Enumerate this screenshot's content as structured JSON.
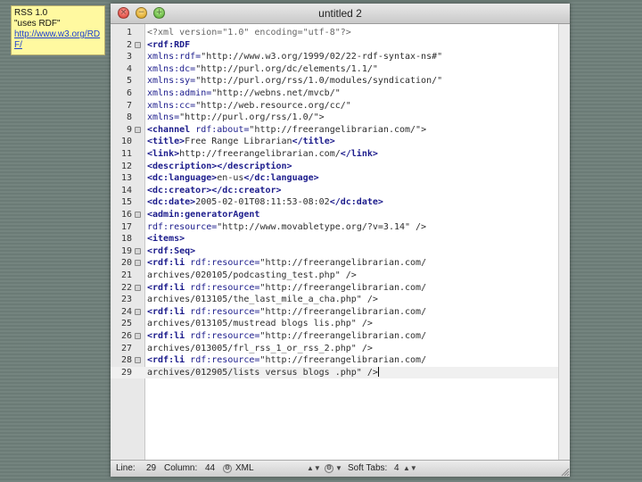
{
  "note": {
    "line1": "RSS 1.0",
    "line2": "\"uses RDF\"",
    "link": "http://www.w3.org/RDF/"
  },
  "window": {
    "title": "untitled 2"
  },
  "editor": {
    "lines": [
      {
        "n": "1",
        "fold": false,
        "parts": [
          [
            "c",
            "<?xml version=\"1.0\" encoding=\"utf-8\"?>"
          ]
        ]
      },
      {
        "n": "2",
        "fold": true,
        "parts": [
          [
            "t",
            "<rdf:RDF"
          ]
        ]
      },
      {
        "n": "3",
        "fold": false,
        "parts": [
          [
            "a",
            "xmlns:rdf="
          ],
          [
            "s",
            "\"http://www.w3.org/1999/02/22-rdf-syntax-ns#\""
          ]
        ]
      },
      {
        "n": "4",
        "fold": false,
        "parts": [
          [
            "a",
            "xmlns:dc="
          ],
          [
            "s",
            "\"http://purl.org/dc/elements/1.1/\""
          ]
        ]
      },
      {
        "n": "5",
        "fold": false,
        "parts": [
          [
            "a",
            "xmlns:sy="
          ],
          [
            "s",
            "\"http://purl.org/rss/1.0/modules/syndication/\""
          ]
        ]
      },
      {
        "n": "6",
        "fold": false,
        "parts": [
          [
            "a",
            "xmlns:admin="
          ],
          [
            "s",
            "\"http://webns.net/mvcb/\""
          ]
        ]
      },
      {
        "n": "7",
        "fold": false,
        "parts": [
          [
            "a",
            "xmlns:cc="
          ],
          [
            "s",
            "\"http://web.resource.org/cc/\""
          ]
        ]
      },
      {
        "n": "8",
        "fold": false,
        "parts": [
          [
            "a",
            "xmlns="
          ],
          [
            "s",
            "\"http://purl.org/rss/1.0/\">"
          ]
        ]
      },
      {
        "n": "9",
        "fold": true,
        "parts": [
          [
            "t",
            "<channel "
          ],
          [
            "a",
            "rdf:about="
          ],
          [
            "s",
            "\"http://freerangelibrarian.com/\">"
          ]
        ]
      },
      {
        "n": "10",
        "fold": false,
        "parts": [
          [
            "t",
            "<title>"
          ],
          [
            "s",
            "Free Range Librarian"
          ],
          [
            "t",
            "</title>"
          ]
        ]
      },
      {
        "n": "11",
        "fold": false,
        "parts": [
          [
            "t",
            "<link>"
          ],
          [
            "s",
            "http://freerangelibrarian.com/"
          ],
          [
            "t",
            "</link>"
          ]
        ]
      },
      {
        "n": "12",
        "fold": false,
        "parts": [
          [
            "t",
            "<description></description>"
          ]
        ]
      },
      {
        "n": "13",
        "fold": false,
        "parts": [
          [
            "t",
            "<dc:language>"
          ],
          [
            "s",
            "en-us"
          ],
          [
            "t",
            "</dc:language>"
          ]
        ]
      },
      {
        "n": "14",
        "fold": false,
        "parts": [
          [
            "t",
            "<dc:creator></dc:creator>"
          ]
        ]
      },
      {
        "n": "15",
        "fold": false,
        "parts": [
          [
            "t",
            "<dc:date>"
          ],
          [
            "s",
            "2005-02-01T08:11:53-08:02"
          ],
          [
            "t",
            "</dc:date>"
          ]
        ]
      },
      {
        "n": "16",
        "fold": true,
        "parts": [
          [
            "t",
            "<admin:generatorAgent"
          ]
        ]
      },
      {
        "n": "17",
        "fold": false,
        "parts": [
          [
            "a",
            "rdf:resource="
          ],
          [
            "s",
            "\"http://www.movabletype.org/?v=3.14\" />"
          ]
        ]
      },
      {
        "n": "18",
        "fold": false,
        "parts": [
          [
            "t",
            "<items>"
          ]
        ]
      },
      {
        "n": "19",
        "fold": true,
        "parts": [
          [
            "t",
            "<rdf:Seq>"
          ]
        ]
      },
      {
        "n": "20",
        "fold": true,
        "parts": [
          [
            "t",
            "<rdf:li "
          ],
          [
            "a",
            "rdf:resource="
          ],
          [
            "s",
            "\"http://freerangelibrarian.com/"
          ]
        ]
      },
      {
        "n": "21",
        "fold": false,
        "parts": [
          [
            "s",
            "archives/020105/podcasting_test.php\" />"
          ]
        ]
      },
      {
        "n": "22",
        "fold": true,
        "parts": [
          [
            "t",
            "<rdf:li "
          ],
          [
            "a",
            "rdf:resource="
          ],
          [
            "s",
            "\"http://freerangelibrarian.com/"
          ]
        ]
      },
      {
        "n": "23",
        "fold": false,
        "parts": [
          [
            "s",
            "archives/013105/the_last_mile_a_cha.php\" />"
          ]
        ]
      },
      {
        "n": "24",
        "fold": true,
        "parts": [
          [
            "t",
            "<rdf:li "
          ],
          [
            "a",
            "rdf:resource="
          ],
          [
            "s",
            "\"http://freerangelibrarian.com/"
          ]
        ]
      },
      {
        "n": "25",
        "fold": false,
        "parts": [
          [
            "s",
            "archives/013105/mustread blogs lis.php\" />"
          ]
        ]
      },
      {
        "n": "26",
        "fold": true,
        "parts": [
          [
            "t",
            "<rdf:li "
          ],
          [
            "a",
            "rdf:resource="
          ],
          [
            "s",
            "\"http://freerangelibrarian.com/"
          ]
        ]
      },
      {
        "n": "27",
        "fold": false,
        "parts": [
          [
            "s",
            "archives/013005/frl_rss_1_or_rss_2.php\" />"
          ]
        ]
      },
      {
        "n": "28",
        "fold": true,
        "parts": [
          [
            "t",
            "<rdf:li "
          ],
          [
            "a",
            "rdf:resource="
          ],
          [
            "s",
            "\"http://freerangelibrarian.com/"
          ]
        ]
      },
      {
        "n": "29",
        "fold": false,
        "cur": true,
        "parts": [
          [
            "s",
            "archives/012905/lists versus blogs .php\" />"
          ]
        ]
      }
    ]
  },
  "status": {
    "line_label": "Line:",
    "line_value": "29",
    "column_label": "Column:",
    "column_value": "44",
    "language": "XML",
    "tabs_label": "Soft Tabs:",
    "tabs_value": "4"
  },
  "colors": {
    "tag": "#1c1c8c",
    "note_bg": "#fff9a0",
    "link": "#1a3ecf"
  }
}
